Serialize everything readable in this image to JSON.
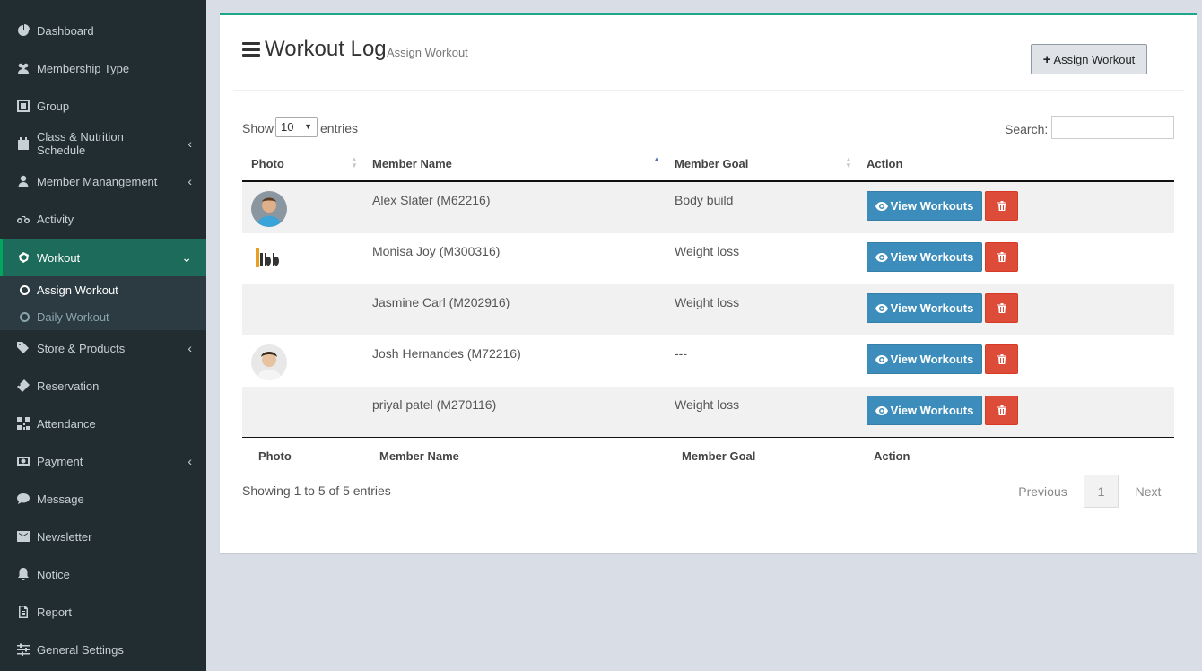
{
  "sidebar": {
    "items": [
      {
        "label": "Dashboard",
        "icon": "dashboard-icon",
        "chevron": ""
      },
      {
        "label": "Membership Type",
        "icon": "users-icon",
        "chevron": ""
      },
      {
        "label": "Group",
        "icon": "group-icon",
        "chevron": ""
      },
      {
        "label": "Class & Nutrition Schedule",
        "icon": "calendar-icon",
        "chevron": "‹"
      },
      {
        "label": "Member Manangement",
        "icon": "user-icon",
        "chevron": "‹"
      },
      {
        "label": "Activity",
        "icon": "bicycle-icon",
        "chevron": ""
      },
      {
        "label": "Workout",
        "icon": "hand-icon",
        "chevron": "⌄"
      },
      {
        "label": "Store & Products",
        "icon": "tags-icon",
        "chevron": "‹"
      },
      {
        "label": "Reservation",
        "icon": "ticket-icon",
        "chevron": ""
      },
      {
        "label": "Attendance",
        "icon": "qrcode-icon",
        "chevron": ""
      },
      {
        "label": "Payment",
        "icon": "money-icon",
        "chevron": "‹"
      },
      {
        "label": "Message",
        "icon": "comment-icon",
        "chevron": ""
      },
      {
        "label": "Newsletter",
        "icon": "envelope-icon",
        "chevron": ""
      },
      {
        "label": "Notice",
        "icon": "bell-icon",
        "chevron": ""
      },
      {
        "label": "Report",
        "icon": "file-icon",
        "chevron": ""
      },
      {
        "label": "General Settings",
        "icon": "sliders-icon",
        "chevron": ""
      }
    ],
    "submenu": [
      {
        "label": "Assign Workout"
      },
      {
        "label": "Daily Workout"
      }
    ]
  },
  "header": {
    "title": "Workout Log",
    "subtitle": "Assign Workout",
    "assign_button": "Assign Workout"
  },
  "table_controls": {
    "show_label": "Show",
    "page_length": "10",
    "entries_label": "entries",
    "search_label": "Search:",
    "search_value": ""
  },
  "table": {
    "columns": [
      "Photo",
      "Member Name",
      "Member Goal",
      "Action"
    ],
    "rows": [
      {
        "name": "Alex Slater (M62216)",
        "goal": "Body build",
        "photo": "avatar"
      },
      {
        "name": "Monisa Joy (M300316)",
        "goal": "Weight loss",
        "photo": "logo"
      },
      {
        "name": "Jasmine Carl (M202916)",
        "goal": "Weight loss",
        "photo": "none"
      },
      {
        "name": "Josh Hernandes (M72216)",
        "goal": "---",
        "photo": "avatar"
      },
      {
        "name": "priyal patel (M270116)",
        "goal": "Weight loss",
        "photo": "none"
      }
    ],
    "view_label": "View Workouts"
  },
  "footer": {
    "info": "Showing 1 to 5 of 5 entries",
    "previous": "Previous",
    "page": "1",
    "next": "Next"
  },
  "colors": {
    "sidebar_bg": "#222d32",
    "active_bg": "#1d6b5b",
    "accent": "#1fa58c",
    "primary_button": "#3c8dbc",
    "danger_button": "#dd4b39"
  }
}
